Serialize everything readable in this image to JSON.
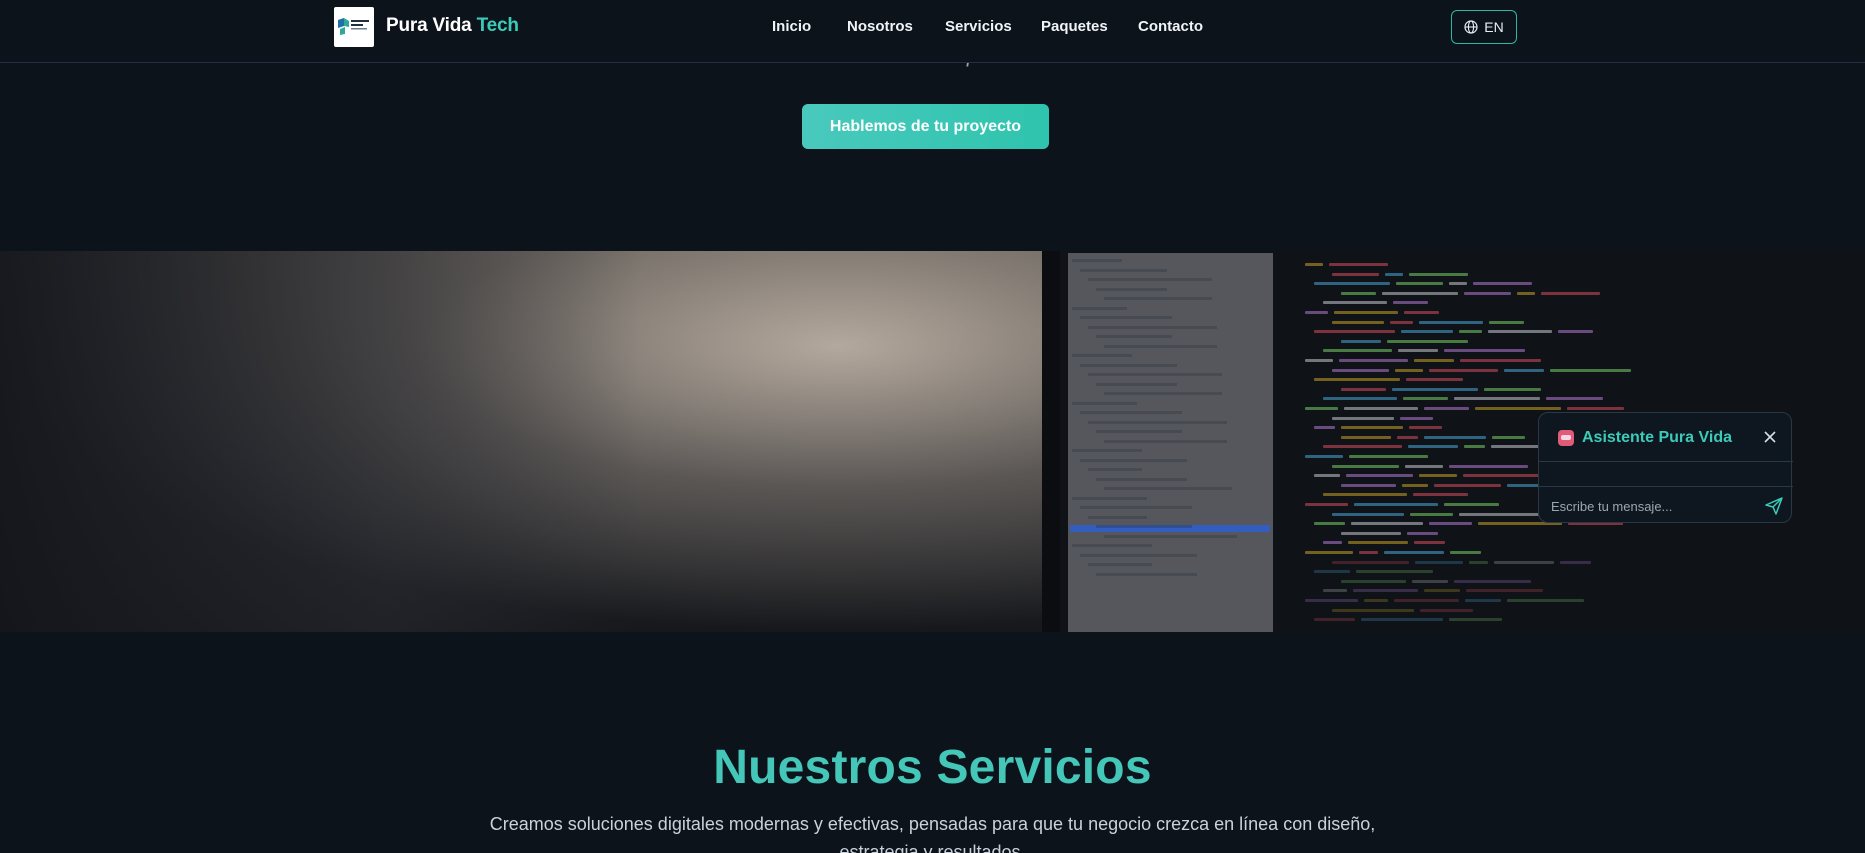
{
  "header": {
    "brand_main": "Pura Vida",
    "brand_accent": "Tech",
    "logo_icon": "pura-vida-tech-logo",
    "nav": [
      "Inicio",
      "Nosotros",
      "Servicios",
      "Paquetes",
      "Contacto"
    ],
    "lang_label": "EN",
    "lang_icon": "globe-icon"
  },
  "hero": {
    "tail_text": "Costa Rica o fuera.",
    "cta_label": "Hablemos de tu proyecto"
  },
  "chat": {
    "title": "Asistente Pura Vida",
    "icon": "robot-icon",
    "input_placeholder": "Escribe tu mensaje...",
    "send_icon": "send-icon",
    "close_icon": "close-icon"
  },
  "services": {
    "title": "Nuestros Servicios",
    "subtitle": "Creamos soluciones digitales modernas y efectivas, pensadas para que tu negocio crezca en línea con diseño, estrategia y resultados."
  },
  "colors": {
    "background": "#0d131b",
    "accent": "#3ccbb8",
    "cta": "#2ec4ad"
  }
}
